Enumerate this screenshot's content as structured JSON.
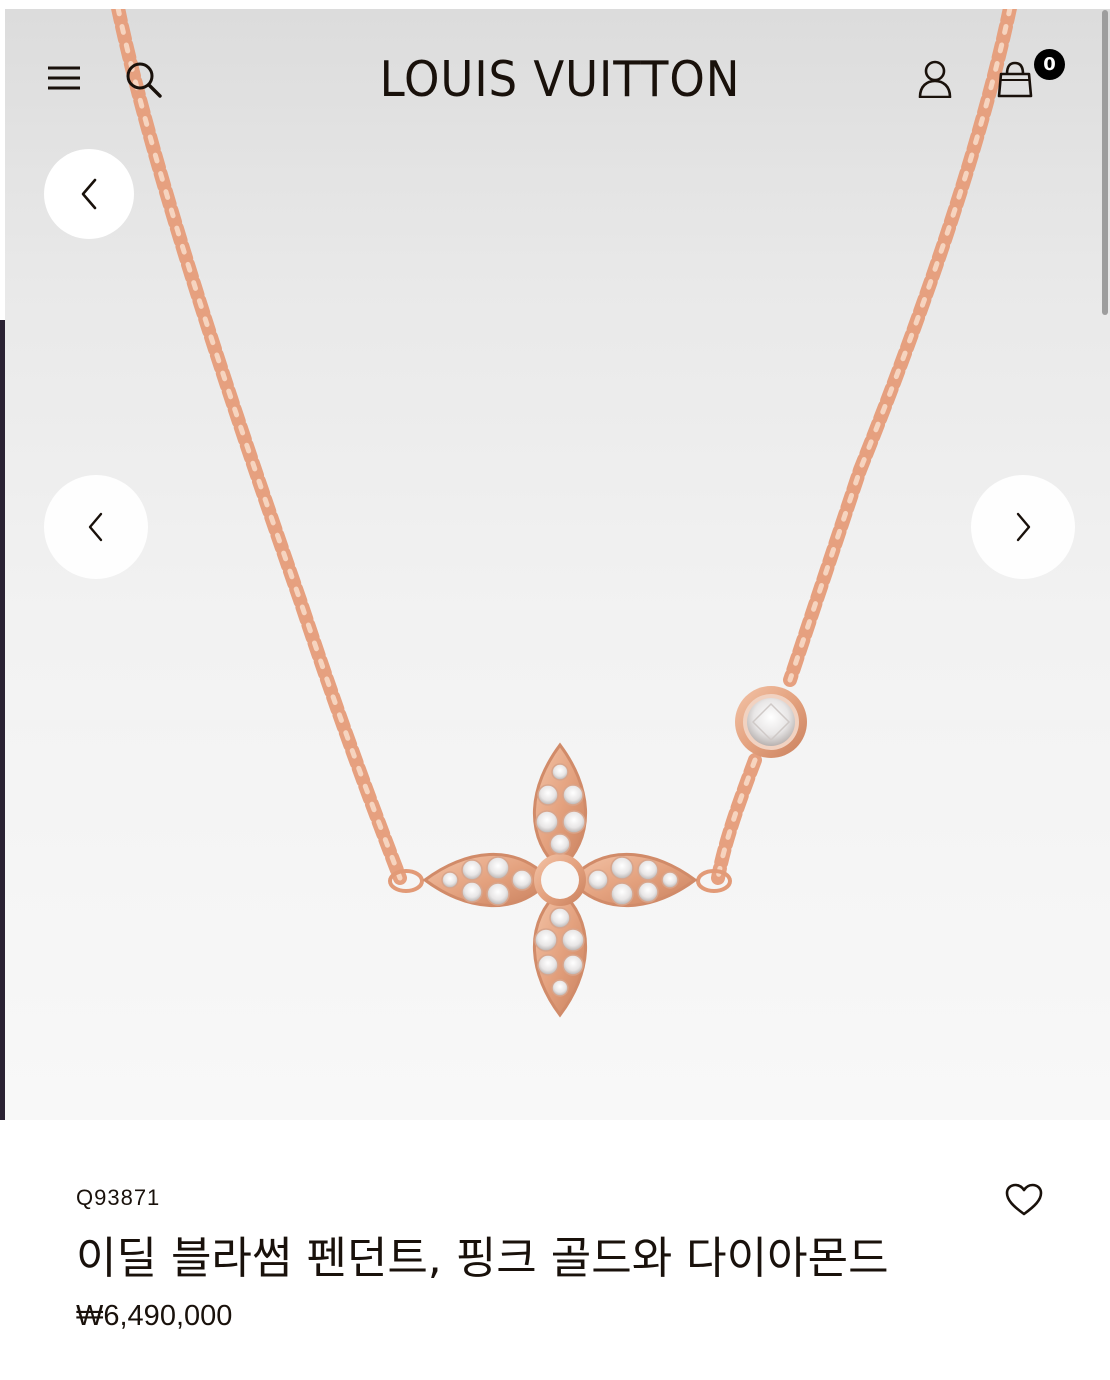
{
  "header": {
    "logo": "LOUIS VUITTON",
    "bag_count": "0"
  },
  "product": {
    "sku": "Q93871",
    "name": "이딜 블라썸 펜던트, 핑크 골드와 다이아몬드",
    "price": "₩6,490,000"
  },
  "icons": {
    "menu": "hamburger-menu-icon",
    "search": "search-icon",
    "account": "user-icon",
    "bag": "shopping-bag-icon",
    "back": "chevron-left-icon",
    "prev": "chevron-left-icon",
    "next": "chevron-right-icon",
    "wishlist": "heart-outline-icon"
  },
  "colors": {
    "text": "#19110b",
    "rose_gold": "#e6a07f",
    "hero_background": "#ececec"
  }
}
